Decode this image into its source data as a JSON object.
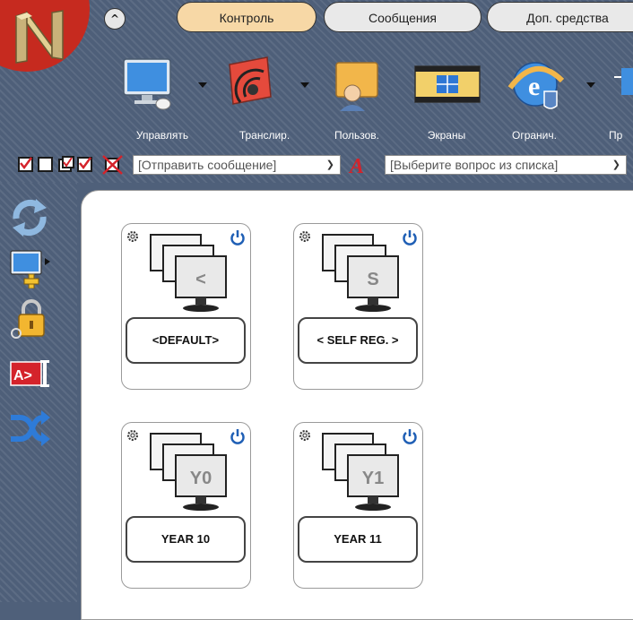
{
  "tabs": {
    "collapse": "^",
    "control": "Контроль",
    "messages": "Сообщения",
    "tools": "Доп. средства"
  },
  "toolbar": {
    "manage": "Управлять",
    "broadcast": "Транслир.",
    "users": "Пользов.",
    "screens": "Экраны",
    "restrict": "Огранич.",
    "next_partial": "Пр"
  },
  "messages": {
    "send_placeholder": "[Отправить сообщение]",
    "question_placeholder": "[Выберите вопрос из списка]"
  },
  "groups": [
    {
      "glyph": "<",
      "name": "<DEFAULT>"
    },
    {
      "glyph": "S",
      "name": "< SELF REG. >"
    },
    {
      "glyph": "Y0",
      "name": "YEAR 10"
    },
    {
      "glyph": "Y1",
      "name": "YEAR 11"
    }
  ],
  "colors": {
    "toolbar_bg": "#4e5f79",
    "active_tab": "#f7d8a6",
    "inactive_tab": "#e9e9e9",
    "power_blue": "#1f5fb5"
  }
}
